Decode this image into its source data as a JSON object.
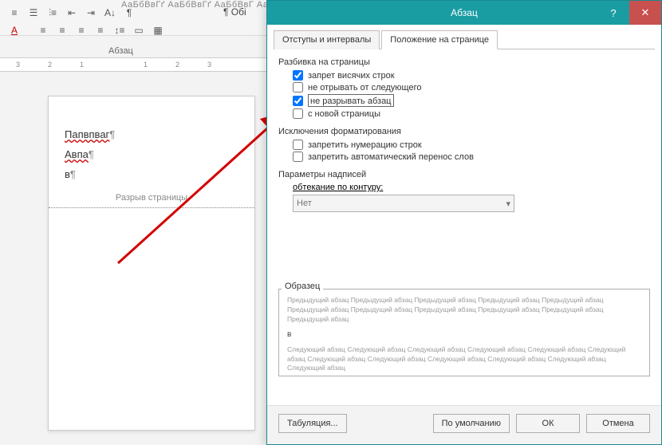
{
  "ribbon": {
    "style_preview_text": "АаБбВвГґ  АаБбВвГґ  АаБбВвГ  АаБбВвГґ  АаБбВвГґ",
    "pilcrow_marker": "¶ Обі",
    "group_label": "Абзац"
  },
  "ruler": {
    "marks": [
      "3",
      "2",
      "1",
      "",
      "1",
      "2",
      "3"
    ]
  },
  "document": {
    "line1": "Папвпваг",
    "line2": "Авпа",
    "line3": "в",
    "page_break_label": "Разрыв страницы"
  },
  "dialog": {
    "title": "Абзац",
    "tabs": {
      "indents": "Отступы и интервалы",
      "position": "Положение на странице"
    },
    "pagination": {
      "legend": "Разбивка на страницы",
      "widow": "запрет висячих строк",
      "keep_with_next": "не отрывать от следующего",
      "keep_together": "не разрывать абзац",
      "page_break_before": "с новой страницы"
    },
    "formatting_exceptions": {
      "legend": "Исключения форматирования",
      "suppress_line_numbers": "запретить нумерацию строк",
      "no_hyphenation": "запретить автоматический перенос слов"
    },
    "textbox_opts": {
      "legend": "Параметры надписей",
      "tight_wrap_label": "обтекание по контуру:",
      "tight_wrap_value": "Нет"
    },
    "sample": {
      "legend": "Образец",
      "prev_text": "Предыдущий абзац Предыдущий абзац Предыдущий абзац Предыдущий абзац Предыдущий абзац Предыдущий абзац Предыдущий абзац Предыдущий абзац Предыдущий абзац Предыдущий абзац Предыдущий абзац",
      "mid": "в",
      "next_text": "Следующий абзац Следующий абзац Следующий абзац Следующий абзац Следующий абзац Следующий абзац Следующий абзац Следующий абзац Следующий абзац Следующий абзац Следующий абзац Следующий абзац"
    },
    "buttons": {
      "tabs": "Табуляция...",
      "default": "По умолчанию",
      "ok": "ОК",
      "cancel": "Отмена"
    },
    "help": "?",
    "close": "✕"
  }
}
